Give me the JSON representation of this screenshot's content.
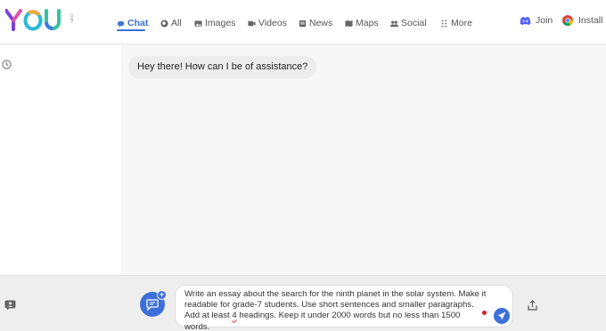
{
  "brand": {
    "name": "YOU",
    "sub": ".com"
  },
  "nav": [
    {
      "label": "Chat",
      "icon": "chat-icon",
      "active": true
    },
    {
      "label": "All",
      "icon": "search-icon"
    },
    {
      "label": "Images",
      "icon": "image-icon"
    },
    {
      "label": "Videos",
      "icon": "video-icon"
    },
    {
      "label": "News",
      "icon": "news-icon"
    },
    {
      "label": "Maps",
      "icon": "map-icon"
    },
    {
      "label": "Social",
      "icon": "people-icon"
    },
    {
      "label": "More",
      "icon": "grid-dots-icon"
    }
  ],
  "actions": {
    "join": "Join",
    "install": "Install"
  },
  "colors": {
    "accent": "#3d6fd9",
    "discord": "#5865f2"
  },
  "chat": {
    "messages": [
      {
        "role": "assistant",
        "text": "Hey there! How can I be of assistance?"
      }
    ]
  },
  "composer": {
    "text_before": "Write an essay about the search for the ninth planet in the solar system. Make it readable for grade-7 students. Use short sentences and smaller paragraphs. Add at least ",
    "text_flagged": "4",
    "text_after": " headings. Keep it under 2000 words but no less than 1500 words."
  }
}
